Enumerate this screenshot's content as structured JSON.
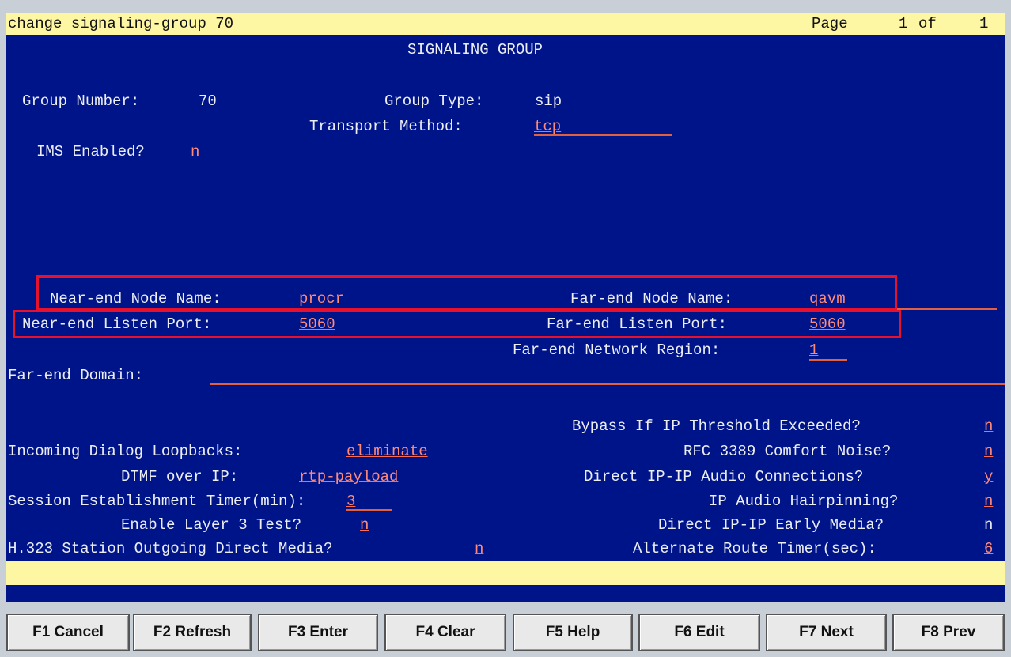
{
  "header": {
    "command": "change signaling-group 70",
    "page_label": "Page",
    "page_current": "1",
    "page_of": "of",
    "page_total": "1"
  },
  "form": {
    "title": "SIGNALING GROUP",
    "group_number_label": "Group Number:",
    "group_number": "70",
    "group_type_label": "Group Type:",
    "group_type": "sip",
    "transport_label": "Transport Method:",
    "transport": "tcp",
    "ims_label": "IMS Enabled?",
    "ims": "n",
    "near_node_label": "Near-end Node Name:",
    "near_node": "procr",
    "far_node_label": "Far-end Node Name:",
    "far_node": "qavm",
    "near_port_label": "Near-end Listen Port:",
    "near_port": "5060",
    "far_port_label": "Far-end Listen Port:",
    "far_port": "5060",
    "far_region_label": "Far-end Network Region:",
    "far_region": "1",
    "far_domain_label": "Far-end Domain:",
    "far_domain": "",
    "bypass_label": "Bypass If IP Threshold Exceeded?",
    "bypass": "n",
    "loopbacks_label": "Incoming Dialog Loopbacks:",
    "loopbacks": "eliminate",
    "rfc_label": "RFC 3389 Comfort Noise?",
    "rfc": "n",
    "dtmf_label": "DTMF over IP:",
    "dtmf": "rtp-payload",
    "direct_audio_label": "Direct IP-IP Audio Connections?",
    "direct_audio": "y",
    "session_timer_label": "Session Establishment Timer(min):",
    "session_timer": "3",
    "hairpin_label": "IP Audio Hairpinning?",
    "hairpin": "n",
    "layer3_label": "Enable Layer 3 Test?",
    "layer3": "n",
    "early_media_label": "Direct IP-IP Early Media?",
    "early_media": "n",
    "h323_label": "H.323 Station Outgoing Direct Media?",
    "h323": "n",
    "alt_route_label": "Alternate Route Timer(sec):",
    "alt_route": "6"
  },
  "function_keys": [
    "F1 Cancel",
    "F2 Refresh",
    "F3 Enter",
    "F4 Clear",
    "F5 Help",
    "F6 Edit",
    "F7 Next",
    "F8 Prev"
  ],
  "colors": {
    "background": "#00148a",
    "bar": "#fdf6a3",
    "highlight_box": "#e8112d",
    "value_text": "#ff8a78"
  }
}
